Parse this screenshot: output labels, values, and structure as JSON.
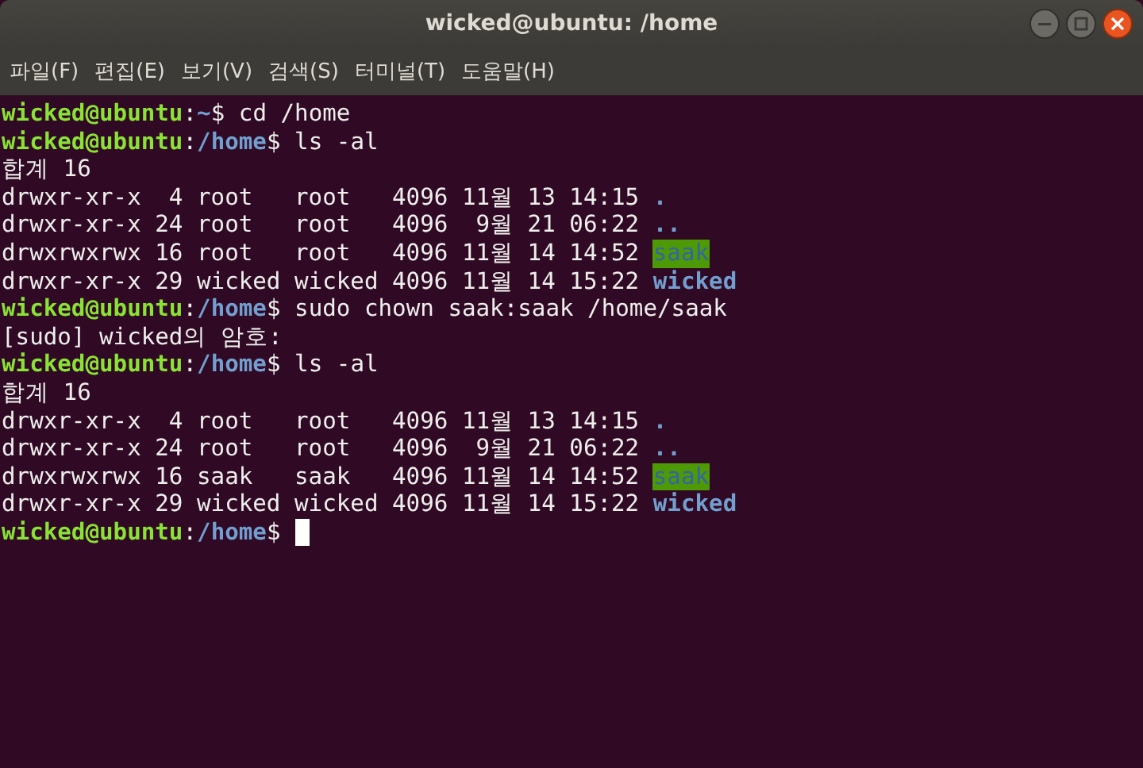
{
  "window": {
    "title": "wicked@ubuntu: /home"
  },
  "menu": [
    "파일(F)",
    "편집(E)",
    "보기(V)",
    "검색(S)",
    "터미널(T)",
    "도움말(H)"
  ],
  "lines": [
    {
      "kind": "prompt",
      "user_host": "wicked@ubuntu",
      "separator": ":",
      "path": "~",
      "symbol": "$",
      "command": " cd /home"
    },
    {
      "kind": "prompt",
      "user_host": "wicked@ubuntu",
      "separator": ":",
      "path": "/home",
      "symbol": "$",
      "command": " ls -al"
    },
    {
      "kind": "output",
      "text": "합계 16"
    },
    {
      "kind": "listing",
      "text": "drwxr-xr-x  4 root   root   4096 11월 13 14:15",
      "file": {
        "name": ".",
        "kind": "dir"
      }
    },
    {
      "kind": "listing",
      "text": "drwxr-xr-x 24 root   root   4096  9월 21 06:22",
      "file": {
        "name": "..",
        "kind": "dir"
      }
    },
    {
      "kind": "listing",
      "text": "drwxrwxrwx 16 root   root   4096 11월 14 14:52",
      "file": {
        "name": "saak",
        "kind": "other_writable"
      }
    },
    {
      "kind": "listing",
      "text": "drwxr-xr-x 29 wicked wicked 4096 11월 14 15:22",
      "file": {
        "name": "wicked",
        "kind": "dir"
      }
    },
    {
      "kind": "prompt",
      "user_host": "wicked@ubuntu",
      "separator": ":",
      "path": "/home",
      "symbol": "$",
      "command": " sudo chown saak:saak /home/saak"
    },
    {
      "kind": "output",
      "text": "[sudo] wicked의 암호:"
    },
    {
      "kind": "prompt",
      "user_host": "wicked@ubuntu",
      "separator": ":",
      "path": "/home",
      "symbol": "$",
      "command": " ls -al"
    },
    {
      "kind": "output",
      "text": "합계 16"
    },
    {
      "kind": "listing",
      "text": "drwxr-xr-x  4 root   root   4096 11월 13 14:15",
      "file": {
        "name": ".",
        "kind": "dir"
      }
    },
    {
      "kind": "listing",
      "text": "drwxr-xr-x 24 root   root   4096  9월 21 06:22",
      "file": {
        "name": "..",
        "kind": "dir"
      }
    },
    {
      "kind": "listing",
      "text": "drwxrwxrwx 16 saak   saak   4096 11월 14 14:52",
      "file": {
        "name": "saak",
        "kind": "other_writable"
      }
    },
    {
      "kind": "listing",
      "text": "drwxr-xr-x 29 wicked wicked 4096 11월 14 15:22",
      "file": {
        "name": "wicked",
        "kind": "dir"
      }
    },
    {
      "kind": "prompt",
      "user_host": "wicked@ubuntu",
      "separator": ":",
      "path": "/home",
      "symbol": "$",
      "cursor": true
    }
  ]
}
